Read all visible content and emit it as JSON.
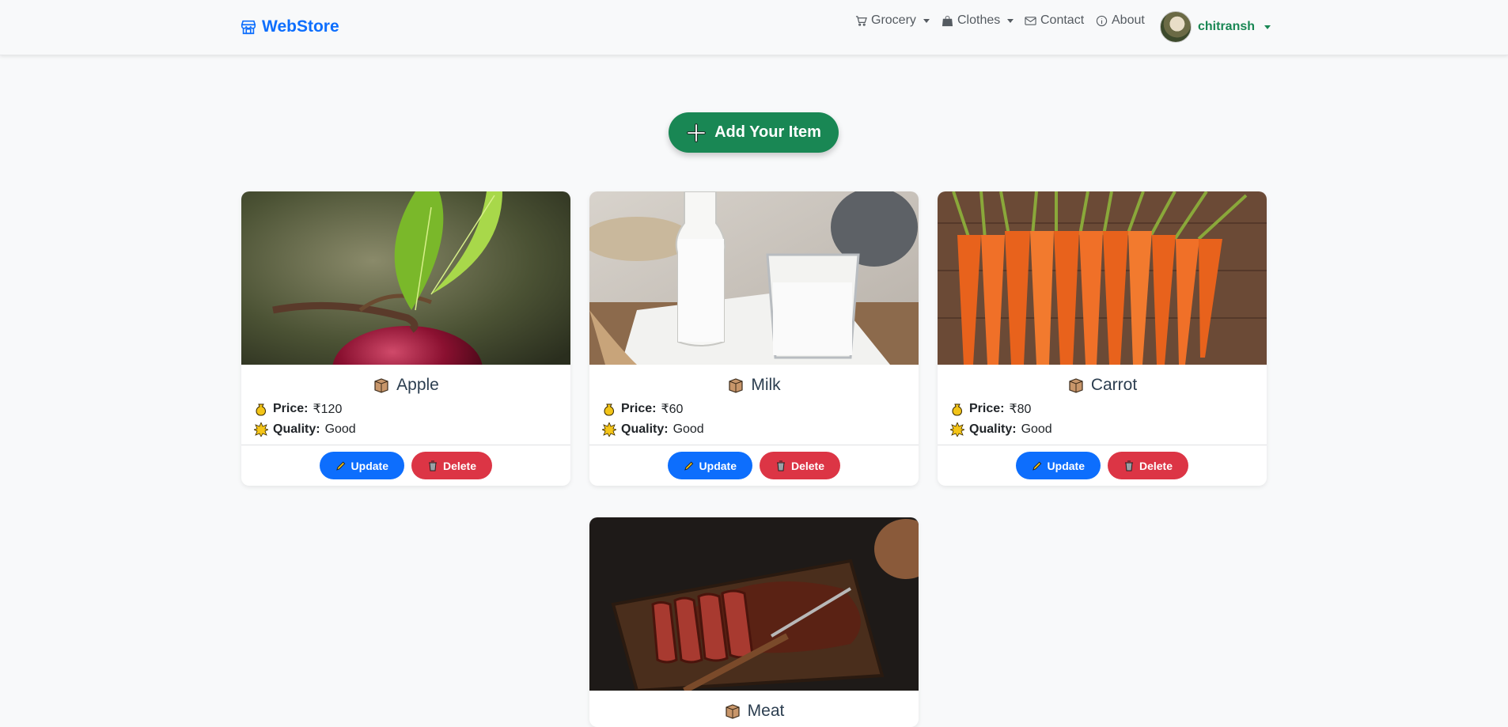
{
  "brand": {
    "name": "WebStore",
    "color": "#0d6efd",
    "icon": "shop-icon"
  },
  "nav": {
    "grocery": "Grocery",
    "clothes": "Clothes",
    "contact": "Contact",
    "about": "About",
    "user": "chitransh"
  },
  "add_button": {
    "label": "Add Your Item",
    "color": "#198754"
  },
  "labels": {
    "price": "Price:",
    "quality": "Quality:"
  },
  "buttons": {
    "update": "Update",
    "delete": "Delete"
  },
  "items": [
    {
      "name": "Apple",
      "price": "₹120",
      "quality": "Good",
      "image": "apple-photo"
    },
    {
      "name": "Milk",
      "price": "₹60",
      "quality": "Good",
      "image": "milk-photo"
    },
    {
      "name": "Carrot",
      "price": "₹80",
      "quality": "Good",
      "image": "carrot-photo"
    },
    {
      "name": "Meat",
      "price": "",
      "quality": "",
      "image": "meat-photo"
    }
  ]
}
